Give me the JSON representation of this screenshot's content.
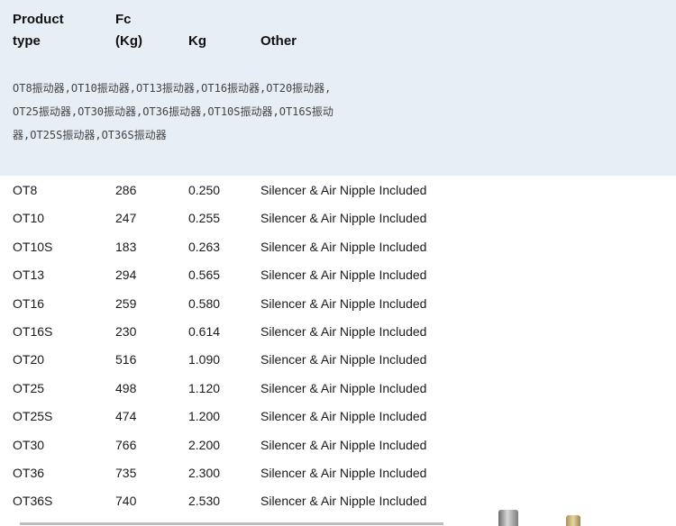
{
  "table": {
    "headers": {
      "product_line1": "Product",
      "product_line2": "type",
      "fc_line1": "Fc",
      "fc_line2": "(Kg)",
      "kg": "Kg",
      "other": "Other"
    },
    "note": "OT8振动器,OT10振动器,OT13振动器,OT16振动器,OT20振动器,OT25振动器,OT30振动器,OT36振动器,OT10S振动器,OT16S振动器,OT25S振动器,OT36S振动器",
    "rows": [
      {
        "type": "OT8",
        "fc": "286",
        "kg": "0.250",
        "other": "Silencer & Air Nipple Included"
      },
      {
        "type": "OT10",
        "fc": "247",
        "kg": "0.255",
        "other": "Silencer & Air Nipple Included"
      },
      {
        "type": "OT10S",
        "fc": "183",
        "kg": "0.263",
        "other": "Silencer & Air Nipple Included"
      },
      {
        "type": "OT13",
        "fc": "294",
        "kg": "0.565",
        "other": "Silencer & Air Nipple Included"
      },
      {
        "type": "OT16",
        "fc": "259",
        "kg": "0.580",
        "other": "Silencer & Air Nipple Included"
      },
      {
        "type": "OT16S",
        "fc": "230",
        "kg": "0.614",
        "other": "Silencer & Air Nipple Included"
      },
      {
        "type": "OT20",
        "fc": "516",
        "kg": "1.090",
        "other": "Silencer & Air Nipple Included"
      },
      {
        "type": "OT25",
        "fc": "498",
        "kg": "1.120",
        "other": "Silencer & Air Nipple Included"
      },
      {
        "type": "OT25S",
        "fc": "474",
        "kg": "1.200",
        "other": "Silencer & Air Nipple Included"
      },
      {
        "type": "OT30",
        "fc": "766",
        "kg": "2.200",
        "other": "Silencer & Air Nipple Included"
      },
      {
        "type": "OT36",
        "fc": "735",
        "kg": "2.300",
        "other": "Silencer & Air Nipple Included"
      },
      {
        "type": "OT36S",
        "fc": "740",
        "kg": "2.530",
        "other": "Silencer & Air Nipple Included"
      }
    ]
  }
}
